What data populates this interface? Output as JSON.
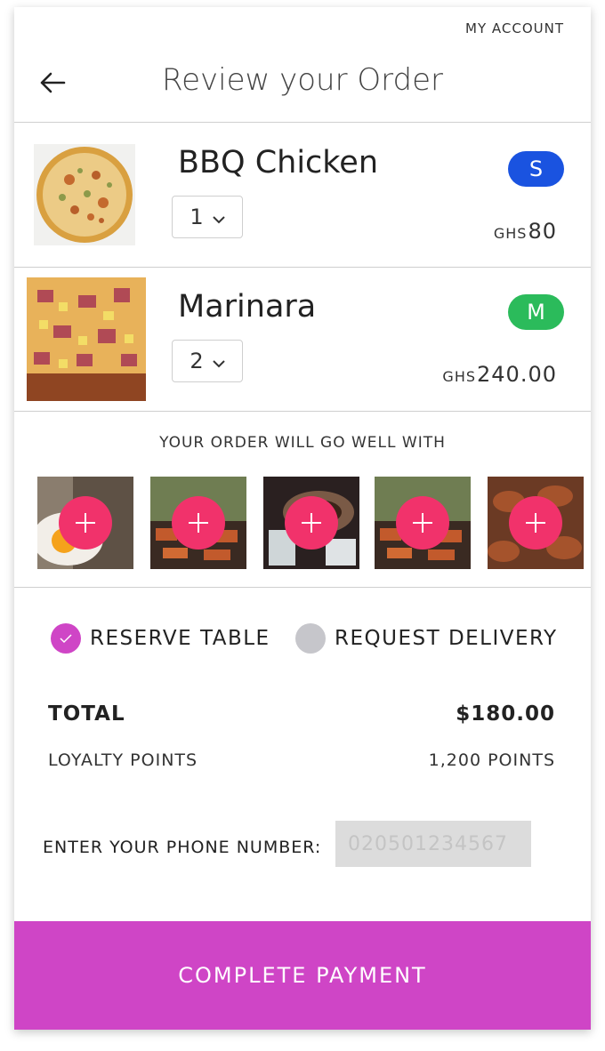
{
  "header": {
    "account_link": "MY ACCOUNT",
    "title": "Review your Order"
  },
  "order_items": [
    {
      "name": "BBQ Chicken",
      "quantity": "1",
      "size": "S",
      "currency": "GHS",
      "price": "80"
    },
    {
      "name": "Marinara",
      "quantity": "2",
      "size": "M",
      "currency": "GHS",
      "price": "240.00"
    }
  ],
  "recommendations": {
    "title": "YOUR ORDER WILL GO WELL WITH"
  },
  "fulfillment": {
    "options": [
      {
        "label": "RESERVE TABLE",
        "selected": true
      },
      {
        "label": "REQUEST DELIVERY",
        "selected": false
      }
    ]
  },
  "summary": {
    "total_label": "TOTAL",
    "total_value": "$180.00",
    "loyalty_label": "LOYALTY POINTS",
    "loyalty_value": "1,200 POINTS"
  },
  "phone": {
    "label": "ENTER YOUR PHONE NUMBER:",
    "placeholder": "020501234567"
  },
  "cta": {
    "label": "COMPLETE PAYMENT"
  },
  "colors": {
    "accent": "#cf45c6",
    "add_button": "#f1326b",
    "size_small": "#1a53e0",
    "size_medium": "#2bbb5b",
    "radio_off": "#c6c6cb"
  }
}
